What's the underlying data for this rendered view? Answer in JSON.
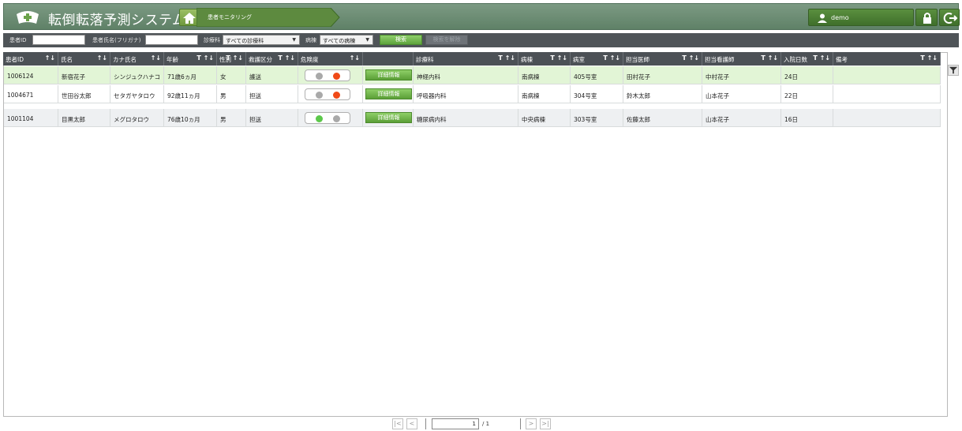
{
  "app": {
    "title": "転倒転落予測システム"
  },
  "breadcrumb": {
    "current": "患者モニタリング"
  },
  "user": {
    "name": "demo"
  },
  "icons": {
    "logo": "nurse-cap-cross-icon",
    "home": "home-icon",
    "user": "user-icon",
    "lock": "lock-icon",
    "logout": "logout-icon",
    "filter": "filter-icon",
    "sort": "sort-icon"
  },
  "colors": {
    "header": "#6d8f75",
    "search_bar": "#4f5458",
    "grid_header": "#4c5156",
    "selected_row": "#e2f5d6",
    "accent_green": "#6aaf45",
    "risk_low": "#5cc84a",
    "risk_high": "#f04a18",
    "risk_off": "#a9a9a9"
  },
  "search": {
    "patient_id_label": "患者ID",
    "patient_id_value": "",
    "kana_label": "患者氏名(フリガナ)",
    "kana_value": "",
    "department_label": "診療科",
    "department_value": "すべての診療科",
    "ward_label": "病棟",
    "ward_value": "すべての病棟",
    "search_button": "検索",
    "clear_button": "検索を解除"
  },
  "columns": [
    {
      "label": "患者ID",
      "icons": "↑↓"
    },
    {
      "label": "氏名",
      "icons": "↑↓"
    },
    {
      "label": "カナ氏名",
      "icons": "↑↓"
    },
    {
      "label": "年齢",
      "icons": "T ↑↓"
    },
    {
      "label": "性別",
      "icons": "T ↑↓"
    },
    {
      "label": "救護区分",
      "icons": "T ↑↓"
    },
    {
      "label": "危険度",
      "icons": "↑↓"
    },
    {
      "label": "",
      "icons": ""
    },
    {
      "label": "診療科",
      "icons": "T ↑↓"
    },
    {
      "label": "病棟",
      "icons": "T ↑↓"
    },
    {
      "label": "病室",
      "icons": "T ↑↓"
    },
    {
      "label": "担当医師",
      "icons": "T ↑↓"
    },
    {
      "label": "担当看護師",
      "icons": "T ↑↓"
    },
    {
      "label": "入院日数",
      "icons": "T ↑↓"
    },
    {
      "label": "備考",
      "icons": "T ↑↓"
    }
  ],
  "rows": [
    {
      "id": "1006124",
      "name": "新宿花子",
      "kana": "シンジュクハナコ",
      "age": "71歳6ヵ月",
      "sex": "女",
      "care": "護送",
      "risk": [
        "off",
        "high"
      ],
      "detail": "詳細情報",
      "dept": "神経内科",
      "ward": "南病棟",
      "room": "405号室",
      "doctor": "田村花子",
      "nurse": "中村花子",
      "days": "24日",
      "note": ""
    },
    {
      "id": "1004671",
      "name": "世田谷太郎",
      "kana": "セタガヤタロウ",
      "age": "92歳11ヵ月",
      "sex": "男",
      "care": "担送",
      "risk": [
        "off",
        "high"
      ],
      "detail": "詳細情報",
      "dept": "呼吸器内科",
      "ward": "南病棟",
      "room": "304号室",
      "doctor": "鈴木太郎",
      "nurse": "山本花子",
      "days": "22日",
      "note": ""
    },
    {
      "id": "1001104",
      "name": "目黒太郎",
      "kana": "メグロタロウ",
      "age": "76歳10ヵ月",
      "sex": "男",
      "care": "担送",
      "risk": [
        "low",
        "off"
      ],
      "detail": "詳細情報",
      "dept": "糖尿病内科",
      "ward": "中央病棟",
      "room": "303号室",
      "doctor": "佐藤太郎",
      "nurse": "山本花子",
      "days": "16日",
      "note": ""
    }
  ],
  "pager": {
    "first": "|<",
    "prev": "<",
    "page": "1",
    "total": "/ 1",
    "next": ">",
    "last": ">|"
  }
}
